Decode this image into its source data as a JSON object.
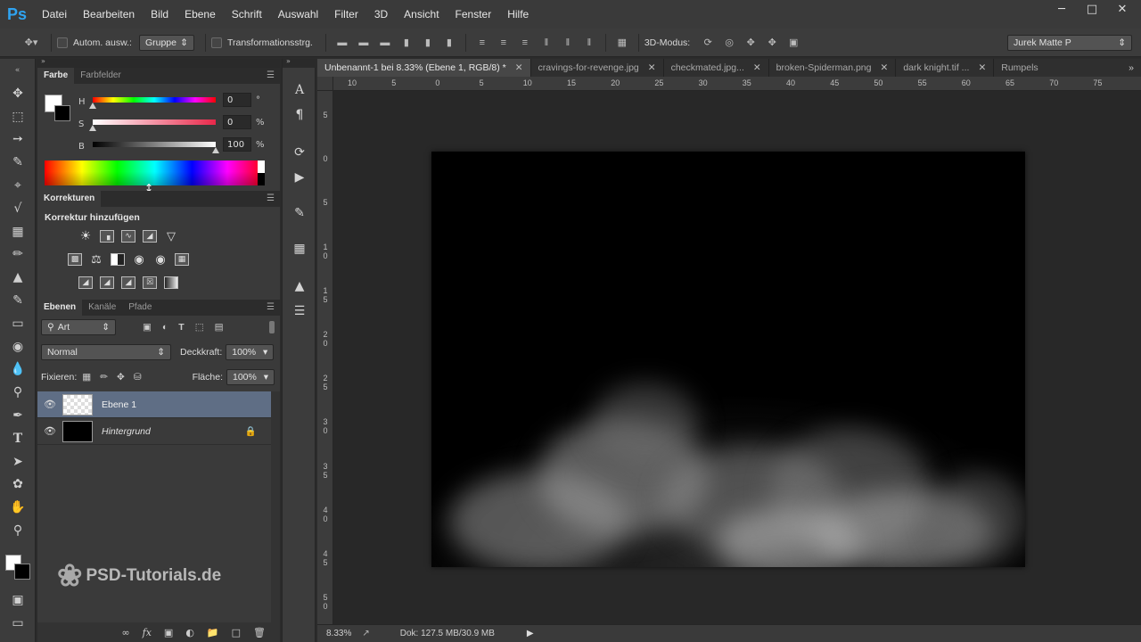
{
  "app": {
    "logo": "Ps"
  },
  "menu": [
    "Datei",
    "Bearbeiten",
    "Bild",
    "Ebene",
    "Schrift",
    "Auswahl",
    "Filter",
    "3D",
    "Ansicht",
    "Fenster",
    "Hilfe"
  ],
  "options": {
    "auto_select_label": "Autom. ausw.:",
    "auto_select_value": "Gruppe",
    "transform_label": "Transformationsstrg.",
    "mode_label": "3D-Modus:",
    "workspace": "Jurek Matte P"
  },
  "color_panel": {
    "tabs": [
      "Farbe",
      "Farbfelder"
    ],
    "sliders": [
      {
        "label": "H",
        "value": "0",
        "unit": "°"
      },
      {
        "label": "S",
        "value": "0",
        "unit": "%"
      },
      {
        "label": "B",
        "value": "100",
        "unit": "%"
      }
    ]
  },
  "adjustments_panel": {
    "tabs": [
      "Korrekturen"
    ],
    "title": "Korrektur hinzufügen"
  },
  "layers_panel": {
    "tabs": [
      "Ebenen",
      "Kanäle",
      "Pfade"
    ],
    "filter_kind": "Art",
    "blend_mode": "Normal",
    "opacity_label": "Deckkraft:",
    "opacity_value": "100%",
    "lock_label": "Fixieren:",
    "fill_label": "Fläche:",
    "fill_value": "100%",
    "layers": [
      {
        "name": "Ebene 1",
        "selected": true
      },
      {
        "name": "Hintergrund",
        "selected": false,
        "locked": true
      }
    ]
  },
  "watermark": "PSD-Tutorials.de",
  "document_tabs": [
    {
      "title": "Unbenannt-1 bei 8.33% (Ebene 1, RGB/8) *",
      "active": true
    },
    {
      "title": "cravings-for-revenge.jpg",
      "active": false
    },
    {
      "title": "checkmated.jpg...",
      "active": false
    },
    {
      "title": "broken-Spiderman.png",
      "active": false
    },
    {
      "title": "dark knight.tif ...",
      "active": false
    },
    {
      "title": "Rumpels",
      "active": false
    }
  ],
  "ruler_top": [
    "10",
    "5",
    "0",
    "5",
    "10",
    "15",
    "20",
    "25",
    "30",
    "35",
    "40",
    "45",
    "50",
    "55",
    "60",
    "65",
    "70",
    "75"
  ],
  "ruler_left": [
    "5",
    "0",
    "5",
    "10",
    "15",
    "20",
    "25",
    "30",
    "35",
    "40",
    "45",
    "50"
  ],
  "status": {
    "zoom": "8.33%",
    "doc_info": "Dok: 127.5 MB/30.9 MB"
  }
}
